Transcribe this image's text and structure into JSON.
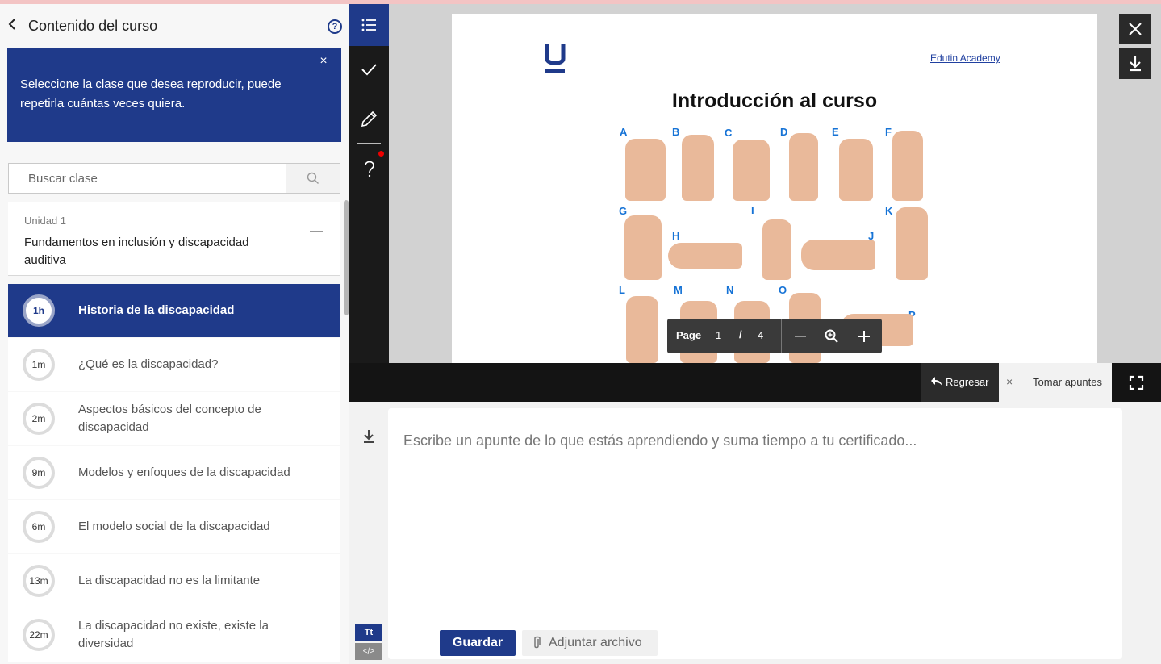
{
  "sidebar": {
    "title": "Contenido del curso",
    "help_icon": "?",
    "notice": "Seleccione la clase que desea reproducir, puede repetirla cuántas veces quiera.",
    "notice_close": "×",
    "search_placeholder": "Buscar clase",
    "unit": {
      "label": "Unidad 1",
      "title": "Fundamentos en inclusión y discapacidad auditiva"
    },
    "lessons": [
      {
        "duration": "1h",
        "title": "Historia de la discapacidad",
        "active": true
      },
      {
        "duration": "1m",
        "title": "¿Qué es la discapacidad?"
      },
      {
        "duration": "2m",
        "title": "Aspectos básicos del concepto de discapacidad"
      },
      {
        "duration": "9m",
        "title": "Modelos y enfoques de la discapacidad"
      },
      {
        "duration": "6m",
        "title": "El modelo social de la discapacidad"
      },
      {
        "duration": "13m",
        "title": "La discapacidad no es la limitante"
      },
      {
        "duration": "22m",
        "title": "La discapacidad no existe, existe la diversidad"
      }
    ]
  },
  "viewer": {
    "slide": {
      "brand_link": "Edutin Academy",
      "title": "Introducción al curso",
      "letters": [
        "A",
        "B",
        "C",
        "D",
        "E",
        "F",
        "G",
        "H",
        "I",
        "J",
        "K",
        "L",
        "M",
        "N",
        "O",
        "P"
      ]
    },
    "pager": {
      "label": "Page",
      "current": "1",
      "separator": "/",
      "total": "4"
    },
    "back_label": "Regresar",
    "notes_tab_close": "×",
    "notes_tab_label": "Tomar apuntes"
  },
  "notes": {
    "placeholder": "Escribe un apunte de lo que estás aprendiendo y suma tiempo a tu certificado...",
    "format_text_label": "Tt",
    "format_code_label": "</>",
    "save_label": "Guardar",
    "attach_label": "Adjuntar archivo"
  },
  "colors": {
    "accent": "#1f3a8a",
    "dark": "#141414",
    "alert_dot": "#ee0000",
    "letter_blue": "#1673d6"
  }
}
